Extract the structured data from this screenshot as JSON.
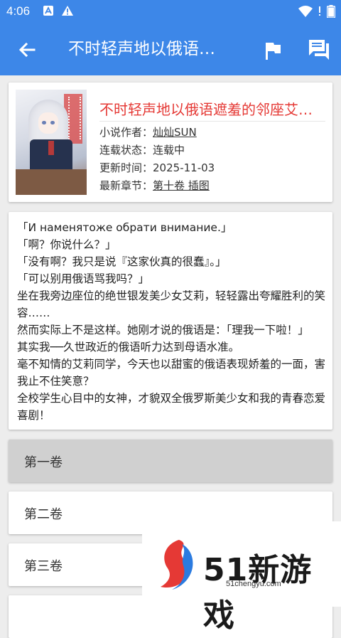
{
  "status_bar": {
    "time": "4:06"
  },
  "app_bar": {
    "title": "不时轻声地以俄语…"
  },
  "book": {
    "title": "不时轻声地以俄语遮羞的邻座艾…",
    "author_label": "小说作者：",
    "author": "灿灿SUN",
    "status_label": "连载状态：",
    "status": "连载中",
    "updated_label": "更新时间：",
    "updated": "2025-11-03",
    "latest_label": "最新章节：",
    "latest": "第十卷 插图"
  },
  "description": "「И наменятоже обрати внимание.」\n「啊？你说什么？」\n「没有啊？我只是说『这家伙真的很蠢』。」\n「可以别用俄语骂我吗？」\n坐在我旁边座位的绝世银发美少女艾莉，轻轻露出夸耀胜利的笑容……\n然而实际上不是这样。她刚才说的俄语是：「理我一下啦！」\n其实我──久世政近的俄语听力达到母语水准。\n毫不知情的艾莉同学，今天也以甜蜜的俄语表现娇羞的一面，害我止不住笑意？\n全校学生心目中的女神，才貌双全俄罗斯美少女和我的青春恋爱喜剧！",
  "volumes": [
    {
      "label": "第一卷",
      "selected": true
    },
    {
      "label": "第二卷",
      "selected": false
    },
    {
      "label": "第三卷",
      "selected": false
    },
    {
      "label": "",
      "selected": false
    }
  ],
  "watermark": {
    "brand": "51新游戏",
    "url": "51chengyu.com"
  },
  "colors": {
    "primary": "#3d87e8",
    "title_red": "#e53935",
    "selected_bg": "#d0d0d0"
  },
  "icons": [
    "back-arrow-icon",
    "flag-icon",
    "comment-icon",
    "wifi-icon",
    "battery-icon",
    "warning-icon",
    "notification-a-icon"
  ]
}
